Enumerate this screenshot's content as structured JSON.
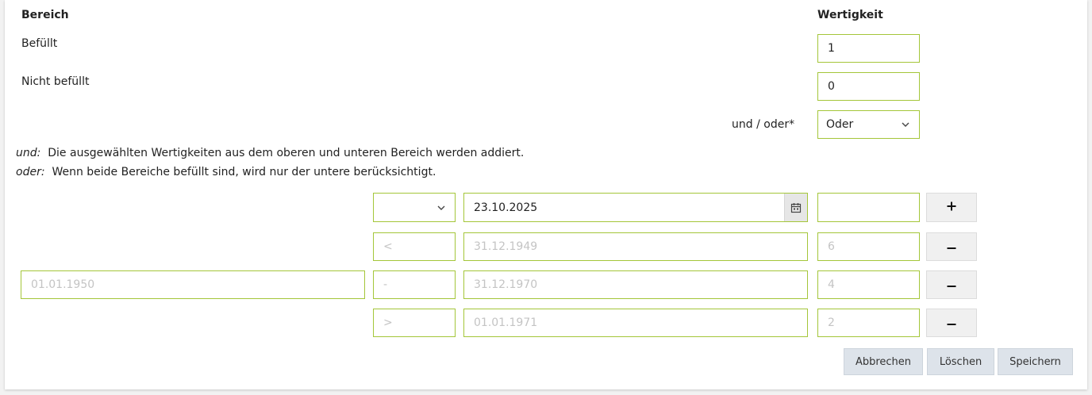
{
  "header": {
    "bereich_label": "Bereich",
    "wertigkeit_label": "Wertigkeit"
  },
  "rows": {
    "befuellt_label": "Befüllt",
    "befuellt_value": "1",
    "nicht_befuellt_label": "Nicht befüllt",
    "nicht_befuellt_value": "0",
    "und_oder_label": "und / oder*",
    "und_oder_selected": "Oder"
  },
  "description": {
    "und_key": "und:",
    "und_text": "Die ausgewählten Wertigkeiten aus dem oberen und unteren Bereich werden addiert.",
    "oder_key": "oder:",
    "oder_text": "Wenn beide Bereiche befüllt sind, wird nur der untere berücksichtigt."
  },
  "ranges": {
    "new_row": {
      "operator": "",
      "date": "23.10.2025",
      "value": ""
    },
    "rows": [
      {
        "start": "",
        "operator": "<",
        "end": "31.12.1949",
        "value": "6"
      },
      {
        "start": "01.01.1950",
        "operator": "-",
        "end": "31.12.1970",
        "value": "4"
      },
      {
        "start": "",
        "operator": ">",
        "end": "01.01.1971",
        "value": "2"
      }
    ]
  },
  "icons": {
    "add": "plus-icon",
    "remove": "minus-icon",
    "calendar": "calendar-icon",
    "dropdown": "chevron-down-icon"
  },
  "footer": {
    "cancel_label": "Abbrechen",
    "delete_label": "Löschen",
    "save_label": "Speichern"
  },
  "colors": {
    "field_border": "#a4c639",
    "button_bg": "#dde3ea"
  }
}
